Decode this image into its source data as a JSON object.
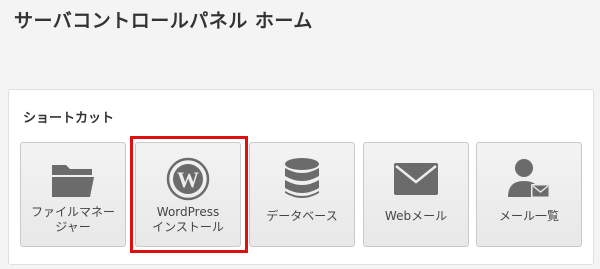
{
  "page": {
    "title": "サーバコントロールパネル ホーム"
  },
  "shortcuts": {
    "title": "ショートカット",
    "items": [
      {
        "label": "ファイルマネー\nジャー",
        "icon": "folder-icon"
      },
      {
        "label": "WordPress\nインストール",
        "icon": "wordpress-icon"
      },
      {
        "label": "データベース",
        "icon": "database-icon"
      },
      {
        "label": "Webメール",
        "icon": "envelope-icon"
      },
      {
        "label": "メール一覧",
        "icon": "user-mail-icon"
      }
    ]
  },
  "colors": {
    "icon": "#6b6b6b",
    "highlight": "#e01010"
  }
}
